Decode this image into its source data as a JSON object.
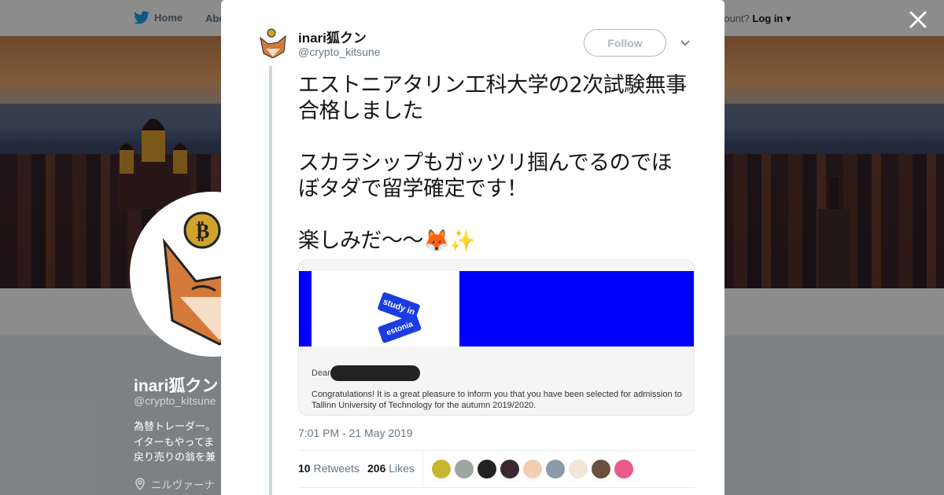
{
  "nav": {
    "home_label": "Home",
    "about_label": "Abo",
    "account_prompt": "account?",
    "login_label": "Log in"
  },
  "profile": {
    "name": "inari狐クン",
    "handle": "@crypto_kitsune",
    "bio": "為替トレーダー。\nイターもやってま\n戻り売りの翁を兼",
    "location": "ニルヴァーナ"
  },
  "tweet": {
    "author_name": "inari狐クン",
    "author_handle": "@crypto_kitsune",
    "follow_label": "Follow",
    "text": "エストニアタリン工科大学の2次試験無事合格しました\n\nスカラシップもガッツリ掴んでるのでほぼタダで留学確定です！\n\n楽しみだ〜〜🦊✨",
    "media": {
      "logo_top": "study in",
      "logo_bottom": "estonia",
      "letter_salutation": "Dear",
      "letter_body": "Congratulations! It is a great pleasure to inform you that you have been selected for admission to Tallinn University of Technology for the autumn 2019/2020."
    },
    "timestamp": "7:01 PM - 21 May 2019",
    "retweets_count": "10",
    "retweets_label": "Retweets",
    "likes_count": "206",
    "likes_label": "Likes",
    "liker_colors": [
      "#c8b630",
      "#9fa6a0",
      "#222222",
      "#3a2a30",
      "#f0d0b0",
      "#8a9aa8",
      "#f3e6d8",
      "#6a5040",
      "#e85a8a"
    ]
  },
  "icons": {
    "twitter": "twitter-bird-icon",
    "close": "close-icon",
    "caret": "chevron-down-icon",
    "location": "location-pin-icon"
  },
  "colors": {
    "accent": "#1da1f2",
    "text": "#14171a",
    "secondary": "#657786"
  }
}
